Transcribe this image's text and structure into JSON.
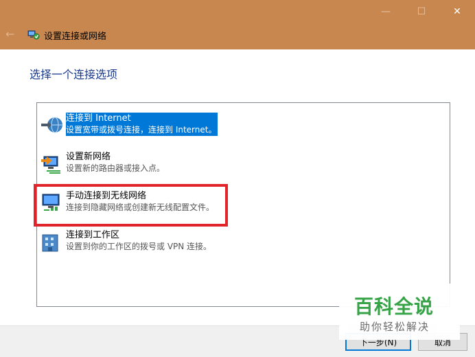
{
  "window": {
    "title": "设置连接或网络",
    "controls": {
      "minimize": "—",
      "maximize": "☐",
      "close": "✕"
    },
    "back": "←"
  },
  "content": {
    "heading": "选择一个连接选项",
    "options": [
      {
        "label": "连接到 Internet",
        "desc": "设置宽带或拨号连接，连接到 Internet。",
        "icon": "globe-network-icon",
        "selected": true
      },
      {
        "label": "设置新网络",
        "desc": "设置新的路由器或接入点。",
        "icon": "new-network-icon",
        "selected": false
      },
      {
        "label": "手动连接到无线网络",
        "desc": "连接到隐藏网络或创建新无线配置文件。",
        "icon": "wireless-network-icon",
        "selected": false
      },
      {
        "label": "连接到工作区",
        "desc": "设置到你的工作区的拨号或 VPN 连接。",
        "icon": "workplace-icon",
        "selected": false
      }
    ]
  },
  "buttons": {
    "next": "下一步(N)",
    "cancel": "取消"
  },
  "watermark": {
    "title": "百科全说",
    "subtitle": "助你轻松解决"
  },
  "colors": {
    "titlebar": "#c8874e",
    "heading": "#1a3a8c",
    "selection": "#0078d7",
    "highlight": "#e0242a",
    "watermark": "#2ea040"
  }
}
